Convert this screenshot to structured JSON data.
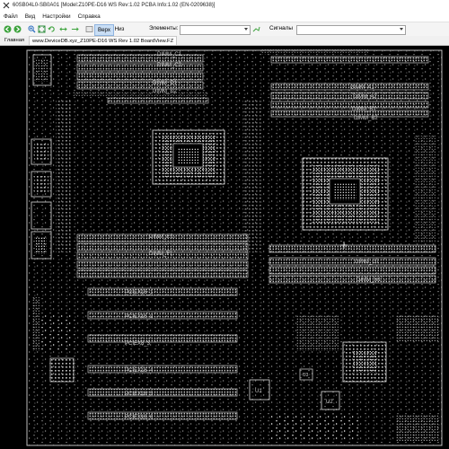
{
  "window": {
    "title": "60SB04L0-SB0A01 [Model:Z10PE-D16 WS Rev:1.02 PCBA Info:1.02 (EN-0209638)]"
  },
  "menu": {
    "items": [
      "Файл",
      "Вид",
      "Настройки",
      "Справка"
    ]
  },
  "toolbar": {
    "top_label": "Верх",
    "bottom_label": "Низ",
    "elements_label": "Элементы:",
    "elements_value": "",
    "signals_label": "Сигналы",
    "signals_value": ""
  },
  "tabs": {
    "home": "Главная",
    "file": "www.DeviceDB.xyz_Z10PE-D16 WS Rev 1.02 BoardView.FZ"
  },
  "board": {
    "labels": {
      "dimm_c1": "DIMM_C1",
      "dimm_c2": "DIMM_C2",
      "dimm_d1": "DIMM_D1",
      "dimm_d2": "DIMM_D2",
      "dimm_e1": "DIMM_E1",
      "dimm_f1": "DIMM_F1",
      "dimm_a1": "DIMM_A1",
      "dimm_a2": "DIMM_A2",
      "dimm_b1": "DIMM_B1",
      "dimm_b2": "DIMM_B2",
      "dimm_g1": "DIMM_G1",
      "dimm_h1": "DIMM_H1",
      "pciex16_1": "PCIEX16_1",
      "pciex16_2": "PCIEX16_2",
      "pciex8_3": "PCIEX8_3",
      "pciex16_4": "PCIEX16_4",
      "pciex16_5": "PCIEX16_5",
      "pciex16_6": "PCIEX16_6",
      "u1": "U1",
      "u2": "U2",
      "u3": "U3"
    }
  },
  "colors": {
    "board_bg": "#000000",
    "outline": "#e8e8e8",
    "label": "#c8c8c8",
    "active_tool": "#c9def5"
  }
}
